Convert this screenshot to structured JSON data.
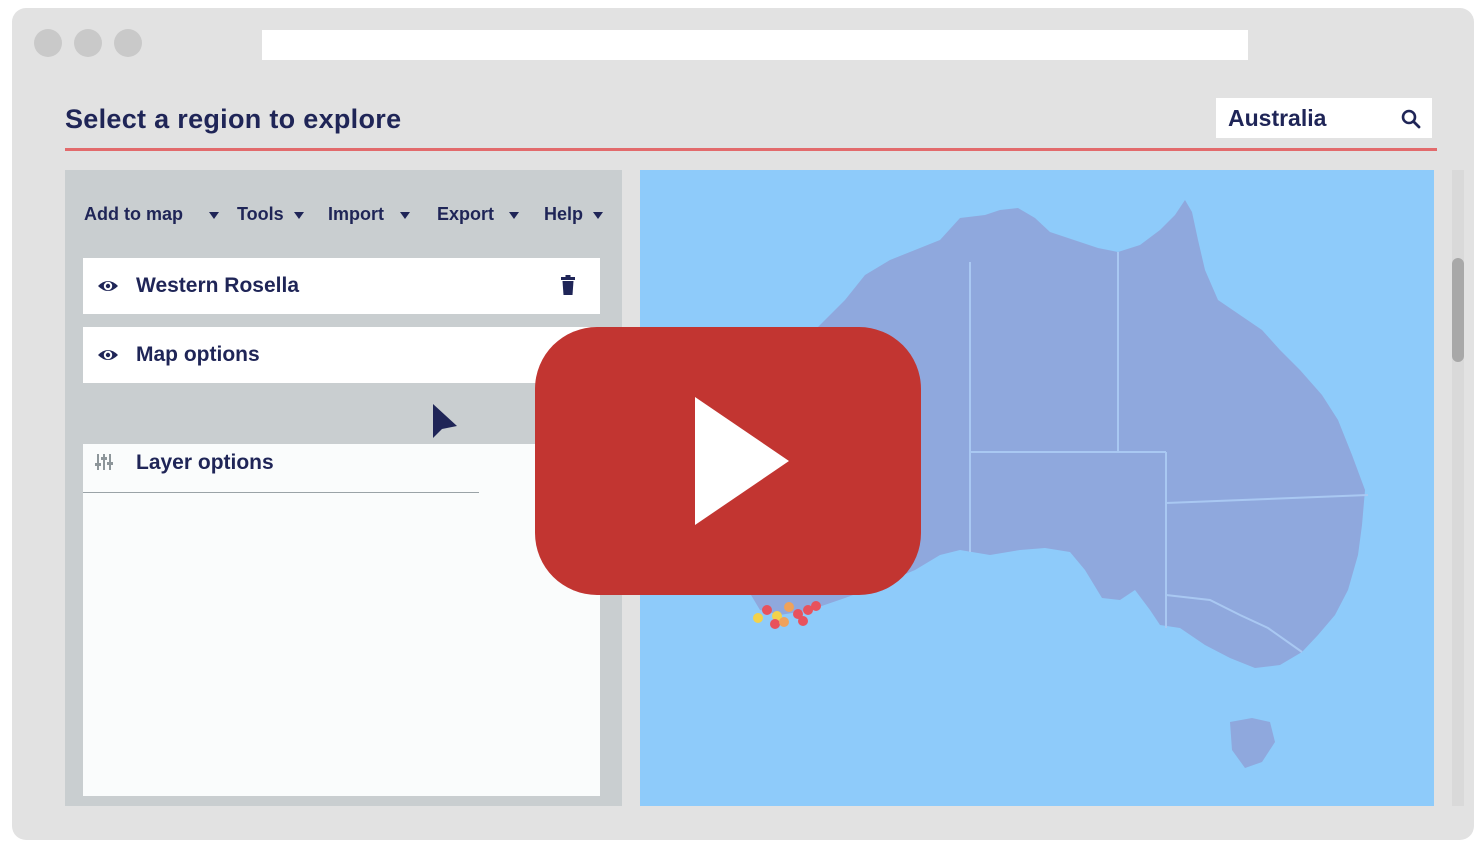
{
  "page": {
    "title": "Select a region to explore"
  },
  "search": {
    "value": "Australia",
    "icon": "search-icon"
  },
  "menu": [
    {
      "label": "Add to map",
      "icon": "caret-down-icon"
    },
    {
      "label": "Tools",
      "icon": "caret-down-icon"
    },
    {
      "label": "Import",
      "icon": "caret-down-icon"
    },
    {
      "label": "Export",
      "icon": "caret-down-icon"
    },
    {
      "label": "Help",
      "icon": "caret-down-icon"
    }
  ],
  "layers": [
    {
      "label": "Western Rosella",
      "visibility_icon": "eye-icon",
      "delete_icon": "trash-icon"
    },
    {
      "label": "Map options",
      "visibility_icon": "eye-icon"
    }
  ],
  "layer_options": {
    "label": "Layer options",
    "icon": "sliders-icon"
  },
  "map": {
    "region": "Australia",
    "ocean_color": "#8ecbfa",
    "land_color": "#8fa8dd",
    "occurrence_colors": [
      "#e8525d",
      "#f0a25a",
      "#f3d24b"
    ]
  },
  "overlay": {
    "icon": "play-icon",
    "color": "#c23531"
  },
  "colors": {
    "accent": "#e26a6c",
    "text": "#1f2557"
  }
}
